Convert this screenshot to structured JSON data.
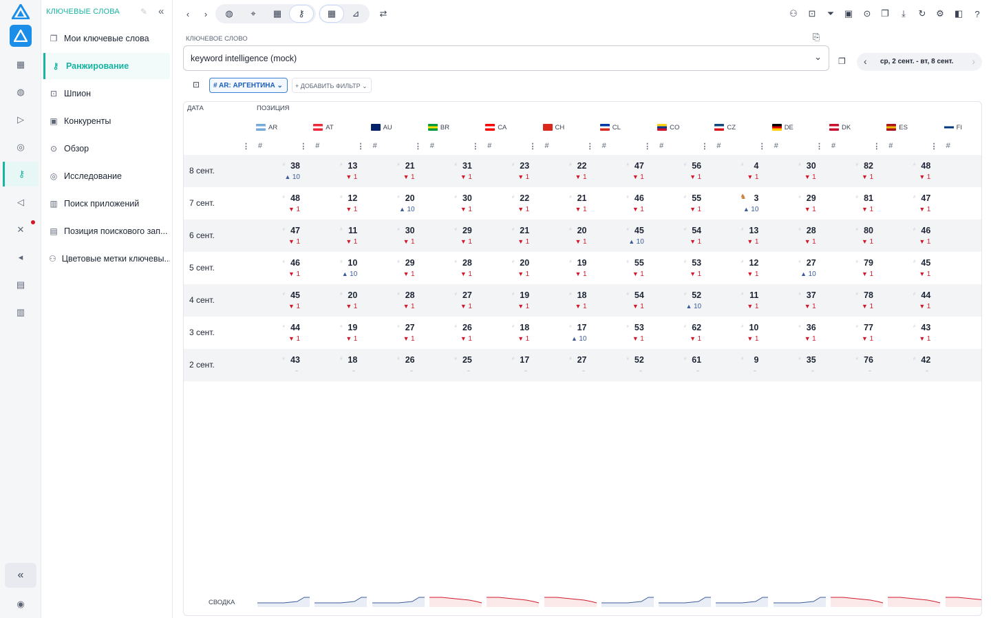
{
  "sidebar": {
    "title": "КЛЮЧЕВЫЕ СЛОВА",
    "items": [
      {
        "label": "Мои ключевые слова",
        "icon": "copy-icon"
      },
      {
        "label": "Ранжирование",
        "icon": "key-icon",
        "active": true
      },
      {
        "label": "Шпион",
        "icon": "car-icon"
      },
      {
        "label": "Конкуренты",
        "icon": "layers-icon"
      },
      {
        "label": "Обзор",
        "icon": "scan-icon"
      },
      {
        "label": "Исследование",
        "icon": "compass-icon"
      },
      {
        "label": "Поиск приложений",
        "icon": "bar-chart-icon"
      },
      {
        "label": "Позиция поискового зап...",
        "icon": "document-icon"
      },
      {
        "label": "Цветовые метки ключевы...",
        "icon": "nodes-icon"
      }
    ]
  },
  "keyword": {
    "label": "КЛЮЧЕВОЕ СЛОВО",
    "value": "keyword intelligence (mock)"
  },
  "date_range": "ср, 2 сент. - вт, 8 сент.",
  "filters": {
    "chip": "# AR: АРГЕНТИНА",
    "add": "+ ДОБАВИТЬ ФИЛЬТР"
  },
  "table": {
    "date_header": "ДАТА",
    "position_header": "ПОЗИЦИЯ",
    "hash": "#",
    "countries": [
      {
        "code": "AR",
        "flag": [
          "#75aadb",
          "#ffffff",
          "#75aadb"
        ]
      },
      {
        "code": "AT",
        "flag": [
          "#ed2939",
          "#ffffff",
          "#ed2939"
        ]
      },
      {
        "code": "AU",
        "flag": [
          "#012169",
          "#012169",
          "#012169"
        ]
      },
      {
        "code": "BR",
        "flag": [
          "#009b3a",
          "#fedf00",
          "#009b3a"
        ]
      },
      {
        "code": "CA",
        "flag": [
          "#ff0000",
          "#ffffff",
          "#ff0000"
        ]
      },
      {
        "code": "CH",
        "flag": [
          "#da291c",
          "#da291c",
          "#da291c"
        ]
      },
      {
        "code": "CL",
        "flag": [
          "#0039a6",
          "#ffffff",
          "#d52b1e"
        ]
      },
      {
        "code": "CO",
        "flag": [
          "#fcd116",
          "#003893",
          "#ce1126"
        ]
      },
      {
        "code": "CZ",
        "flag": [
          "#11457e",
          "#ffffff",
          "#d7141a"
        ]
      },
      {
        "code": "DE",
        "flag": [
          "#000000",
          "#dd0000",
          "#ffce00"
        ]
      },
      {
        "code": "DK",
        "flag": [
          "#c8102e",
          "#ffffff",
          "#c8102e"
        ]
      },
      {
        "code": "ES",
        "flag": [
          "#aa151b",
          "#f1bf00",
          "#aa151b"
        ]
      },
      {
        "code": "FI",
        "flag": [
          "#ffffff",
          "#003580",
          "#ffffff"
        ]
      }
    ],
    "rows": [
      {
        "date": "8 сент.",
        "values": [
          "38",
          "13",
          "21",
          "31",
          "23",
          "22",
          "47",
          "56",
          "4",
          "30",
          "82",
          "48"
        ],
        "changes": [
          "u10",
          "d1",
          "d1",
          "d1",
          "d1",
          "d1",
          "d1",
          "d1",
          "d1",
          "d1",
          "d1",
          "d1"
        ]
      },
      {
        "date": "7 сент.",
        "values": [
          "48",
          "12",
          "20",
          "30",
          "22",
          "21",
          "46",
          "55",
          "3",
          "29",
          "81",
          "47"
        ],
        "changes": [
          "d1",
          "d1",
          "u10",
          "d1",
          "d1",
          "d1",
          "d1",
          "d1",
          "u10",
          "d1",
          "d1",
          "d1"
        ]
      },
      {
        "date": "6 сент.",
        "values": [
          "47",
          "11",
          "30",
          "29",
          "21",
          "20",
          "45",
          "54",
          "13",
          "28",
          "80",
          "46"
        ],
        "changes": [
          "d1",
          "d1",
          "d1",
          "d1",
          "d1",
          "d1",
          "u10",
          "d1",
          "d1",
          "d1",
          "d1",
          "d1"
        ]
      },
      {
        "date": "5 сент.",
        "values": [
          "46",
          "10",
          "29",
          "28",
          "20",
          "19",
          "55",
          "53",
          "12",
          "27",
          "79",
          "45"
        ],
        "changes": [
          "d1",
          "u10",
          "d1",
          "d1",
          "d1",
          "d1",
          "d1",
          "d1",
          "d1",
          "u10",
          "d1",
          "d1"
        ]
      },
      {
        "date": "4 сент.",
        "values": [
          "45",
          "20",
          "28",
          "27",
          "19",
          "18",
          "54",
          "52",
          "11",
          "37",
          "78",
          "44"
        ],
        "changes": [
          "d1",
          "d1",
          "d1",
          "d1",
          "d1",
          "d1",
          "d1",
          "u10",
          "d1",
          "d1",
          "d1",
          "d1"
        ]
      },
      {
        "date": "3 сент.",
        "values": [
          "44",
          "19",
          "27",
          "26",
          "18",
          "17",
          "53",
          "62",
          "10",
          "36",
          "77",
          "43"
        ],
        "changes": [
          "d1",
          "d1",
          "d1",
          "d1",
          "d1",
          "u10",
          "d1",
          "d1",
          "d1",
          "d1",
          "d1",
          "d1"
        ]
      },
      {
        "date": "2 сент.",
        "values": [
          "43",
          "18",
          "26",
          "25",
          "17",
          "27",
          "52",
          "61",
          "9",
          "35",
          "76",
          "42"
        ],
        "changes": [
          "",
          "",
          "",
          "",
          "",
          "",
          "",
          "",
          "",
          "",
          "",
          ""
        ]
      }
    ],
    "summary_label": "СВОДКА",
    "spark_trends": [
      "up",
      "up",
      "up",
      "down",
      "down",
      "down",
      "up",
      "up",
      "up",
      "up",
      "down",
      "down",
      "down"
    ]
  }
}
